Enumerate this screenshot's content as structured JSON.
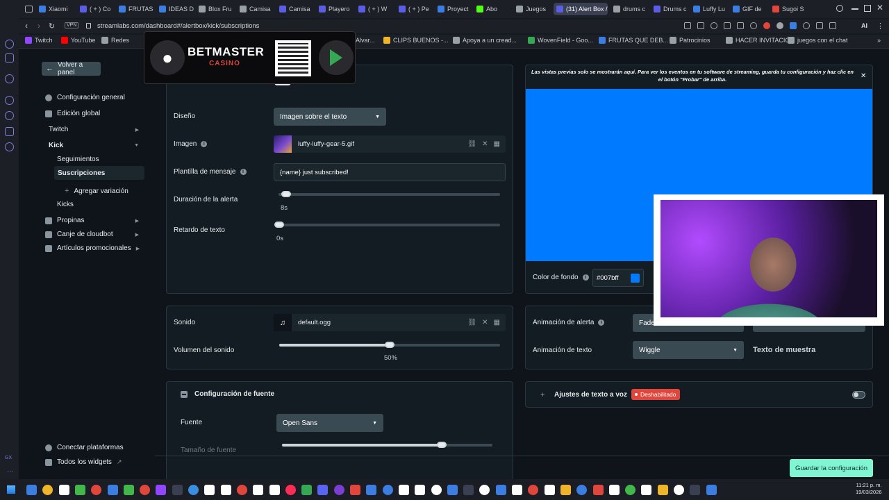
{
  "browser": {
    "tabs": [
      {
        "label": "Xiaomi",
        "color": "#3b7de0"
      },
      {
        "label": "( + ) Co",
        "color": "#5b5ee5"
      },
      {
        "label": "FRUTAS",
        "color": "#3b7de0"
      },
      {
        "label": "IDEAS D",
        "color": "#3b7de0"
      },
      {
        "label": "Blox Fru",
        "color": "#9aa0a8"
      },
      {
        "label": "Camisa",
        "color": "#9aa0a8"
      },
      {
        "label": "Camisa",
        "color": "#5b5ee5"
      },
      {
        "label": "Playero",
        "color": "#5b5ee5"
      },
      {
        "label": "( + ) W",
        "color": "#5b5ee5"
      },
      {
        "label": "( + ) Pe",
        "color": "#5b5ee5"
      },
      {
        "label": "Proyect",
        "color": "#3b7de0"
      },
      {
        "label": "Abo",
        "color": "#53fc18"
      },
      {
        "label": "Juegos",
        "color": "#9aa0a8"
      },
      {
        "label": "(31) Alert Box /",
        "color": "#5b5ee5"
      },
      {
        "label": "drums c",
        "color": "#9aa0a8"
      },
      {
        "label": "Drums c",
        "color": "#5b5ee5"
      },
      {
        "label": "Luffy Lu",
        "color": "#3b7de0"
      },
      {
        "label": "GIF de",
        "color": "#3b7de0"
      },
      {
        "label": "Sugoi S",
        "color": "#e0463b"
      }
    ],
    "url": "streamlabs.com/dashboard#/alertbox/kick/subscriptions",
    "vpn_label": "VPN",
    "bookmarks": [
      "Twitch",
      "YouTube",
      "Redes",
      "Alvar...",
      "CLIPS BUENOS -...",
      "Apoya a un cread...",
      "WovenField - Goo...",
      "FRUTAS QUE DEB...",
      "Patrocinios",
      "HACER INVITACIO...",
      "juegos con el chat"
    ],
    "ai_label": "AI"
  },
  "ad": {
    "brand": "BETMASTER",
    "sub": "CASINO"
  },
  "sidebar": {
    "back_label": "Volver a panel",
    "items": [
      {
        "label": "Configuración general",
        "icon": "gear-icon"
      },
      {
        "label": "Edición global",
        "icon": "grid-icon"
      }
    ],
    "twitch": "Twitch",
    "kick": "Kick",
    "kick_children": [
      "Seguimientos",
      "Suscripciones"
    ],
    "add_variation": "Agregar variación",
    "kicks": "Kicks",
    "more": [
      "Propinas",
      "Canje de cloudbot",
      "Artículos promocionales"
    ],
    "bottom": [
      "Conectar plataformas",
      "Todos los widgets"
    ]
  },
  "form": {
    "design_label": "Diseño",
    "design_value": "Imagen sobre el texto",
    "image_label": "Imagen",
    "image_file": "luffy-luffy-gear-5.gif",
    "template_label": "Plantilla de mensaje",
    "template_value": "{name} just subscribed!",
    "duration_label": "Duración de la alerta",
    "duration_value": "8s",
    "duration_level": 0.02,
    "text_delay_label": "Retardo de texto",
    "text_delay_value": "0s",
    "text_delay_level": 0.0,
    "sound_label": "Sonido",
    "sound_file": "default.ogg",
    "volume_label": "Volumen del sonido",
    "volume_value": "50%",
    "volume_level": 0.5,
    "font_section": "Configuración de fuente",
    "font_label": "Fuente",
    "font_value": "Open Sans",
    "font_size_label": "Tamaño de fuente",
    "font_size_level": 0.76
  },
  "preview": {
    "notice": "Las vistas previas solo se mostrarán aquí. Para ver los eventos en tu software de streaming, guarda tu configuración y haz clic en el botón \"Probar\" de arriba.",
    "bg_color": "#007bff",
    "bg_label": "Color de fondo",
    "bg_value": "#007bff",
    "alert_anim_label": "Animación de alerta",
    "alert_anim_value": "Fade I",
    "text_anim_label": "Animación de texto",
    "text_anim_value": "Wiggle",
    "sample_text": "Texto de muestra",
    "tts_label": "Ajustes de texto a voz",
    "tts_badge": "Deshabilitado"
  },
  "save_label": "Guardar la configuración",
  "taskbar": {
    "time": "11:21 p. m.",
    "date": "19/03/2026"
  },
  "colors": {
    "accent": "#80f5d2",
    "preview_blue": "#007bff",
    "disabled_red": "#e0463b"
  }
}
